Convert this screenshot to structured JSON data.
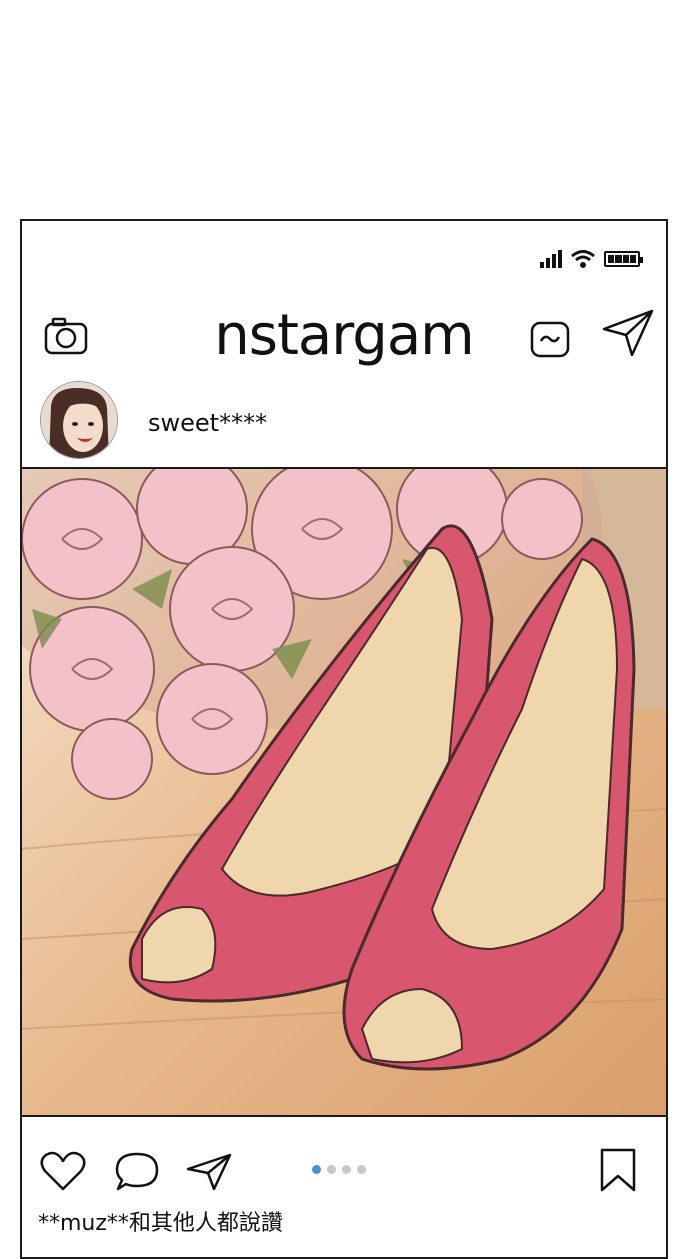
{
  "app": {
    "title": "nstargam"
  },
  "post": {
    "username": "sweet****",
    "carousel": {
      "total": 4,
      "active": 1
    },
    "likes_text": "**muz**和其他人都說讚"
  },
  "icons": {
    "status": [
      "signal-icon",
      "wifi-icon",
      "battery-icon"
    ],
    "header": [
      "camera-icon",
      "tv-icon",
      "direct-message-icon"
    ],
    "actions": [
      "heart-icon",
      "comment-icon",
      "share-icon",
      "bookmark-icon"
    ]
  },
  "colors": {
    "accent": "#4a90d9",
    "shoe": "#d9566f",
    "roses": "#f2b8c0"
  }
}
